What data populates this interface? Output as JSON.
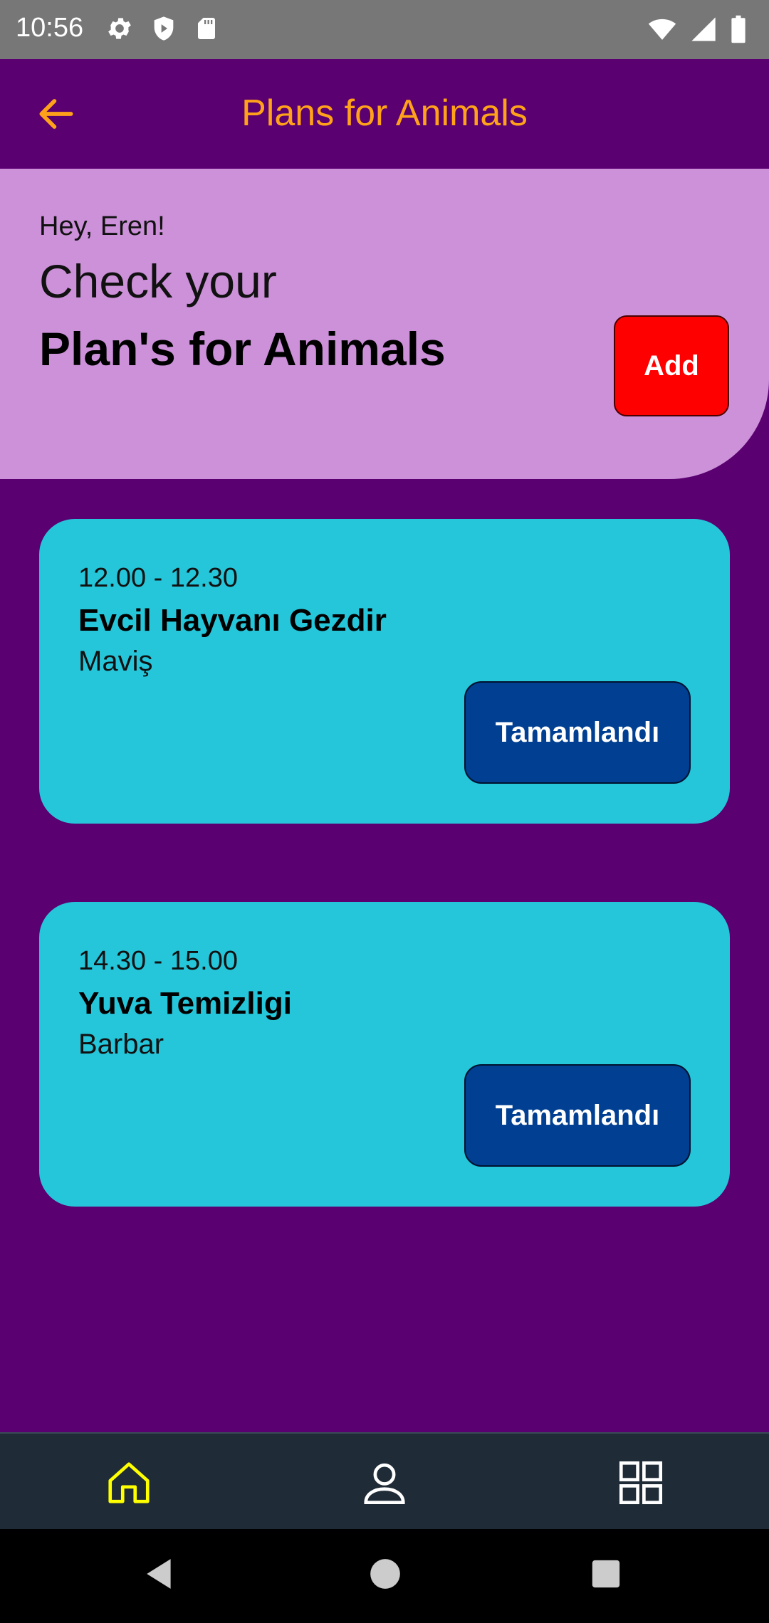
{
  "status_bar": {
    "time": "10:56",
    "left_icons": [
      "gear-icon",
      "shield-icon",
      "sd-card-icon"
    ],
    "right_icons": [
      "wifi-icon",
      "signal-icon",
      "battery-icon"
    ]
  },
  "app_bar": {
    "title": "Plans for Animals",
    "back_icon": "arrow-left-icon",
    "title_color": "#ffa21a"
  },
  "header": {
    "greeting": "Hey, Eren!",
    "line1": "Check your",
    "line2": "Plan's for Animals",
    "add_label": "Add"
  },
  "plans": [
    {
      "time": "12.00 - 12.30",
      "title": "Evcil Hayvanı Gezdir",
      "animal": "Maviş",
      "button_label": "Tamamlandı"
    },
    {
      "time": "14.30 - 15.00",
      "title": "Yuva Temizligi",
      "animal": "Barbar",
      "button_label": "Tamamlandı"
    }
  ],
  "bottom_nav": {
    "items": [
      "home-icon",
      "person-icon",
      "grid-icon"
    ],
    "active": "home-icon",
    "active_color": "#ffff00"
  },
  "system_nav": [
    "back-triangle-icon",
    "home-circle-icon",
    "recents-square-icon"
  ],
  "colors": {
    "background": "#5a0070",
    "header_card": "#cc91d9",
    "plan_card": "#26c6da",
    "add_button": "#ff0000",
    "done_button": "#003f91"
  }
}
